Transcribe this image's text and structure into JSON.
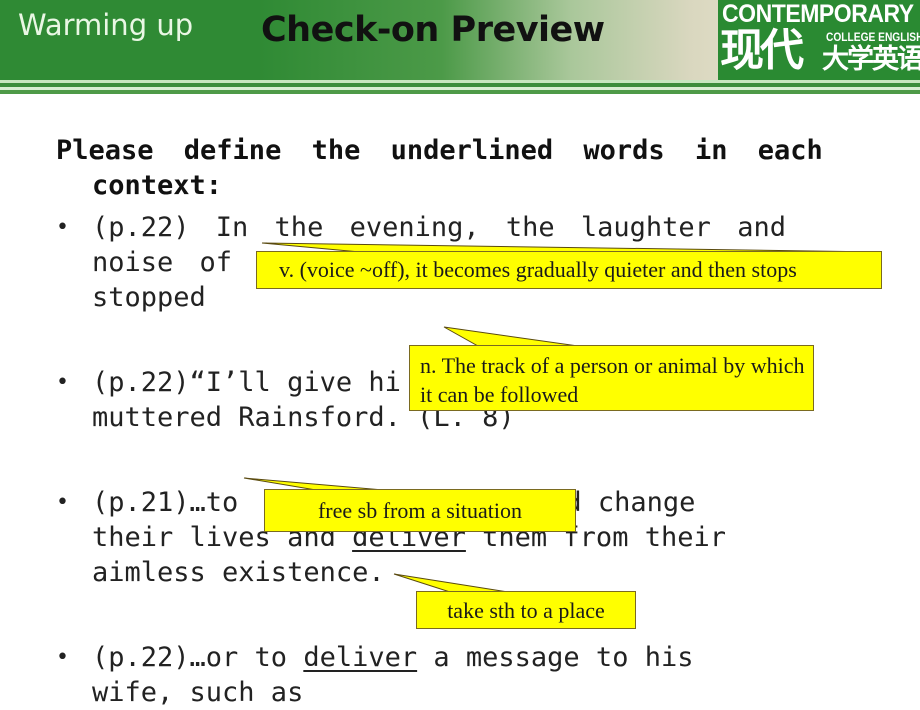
{
  "header": {
    "section_label": "Warming up",
    "title": "Check-on Preview",
    "logo": {
      "english_title": "CONTEMPORARY",
      "english_subtitle": "COLLEGE ENGLISH",
      "chinese_big": "现代",
      "chinese_small": "大学英语"
    }
  },
  "intro": {
    "line1": "Please define the underlined words in each",
    "line2": "context:"
  },
  "bullets": [
    {
      "line1": "(p.22) In the evening, the laughter and",
      "line2": "noise of",
      "line3": "stopped"
    },
    {
      "line1": "(p.22)“I’ll give hi",
      "line2": "muttered Rainsford. (L. 8)"
    },
    {
      "line1_pre": "(p.21)…to",
      "line1_post": "would change",
      "line2_pre": "their lives and ",
      "line2_underlined": "deliver",
      "line2_post": " them from their",
      "line3": "aimless existence."
    },
    {
      "line1_pre": "(p.22)…or to ",
      "line1_underlined": "deliver",
      "line1_post": " a message to his",
      "line2": "wife, such as"
    }
  ],
  "callouts": [
    {
      "text": "v. (voice ~off), it becomes gradually quieter and then stops"
    },
    {
      "text": "n. The track of a person or animal by which it can be followed"
    },
    {
      "text": "free sb from a situation"
    },
    {
      "text": "take sth to a place"
    }
  ],
  "colors": {
    "header_green": "#2f8a34",
    "callout_yellow": "#ffff00",
    "logo_green": "#2a8a32"
  }
}
